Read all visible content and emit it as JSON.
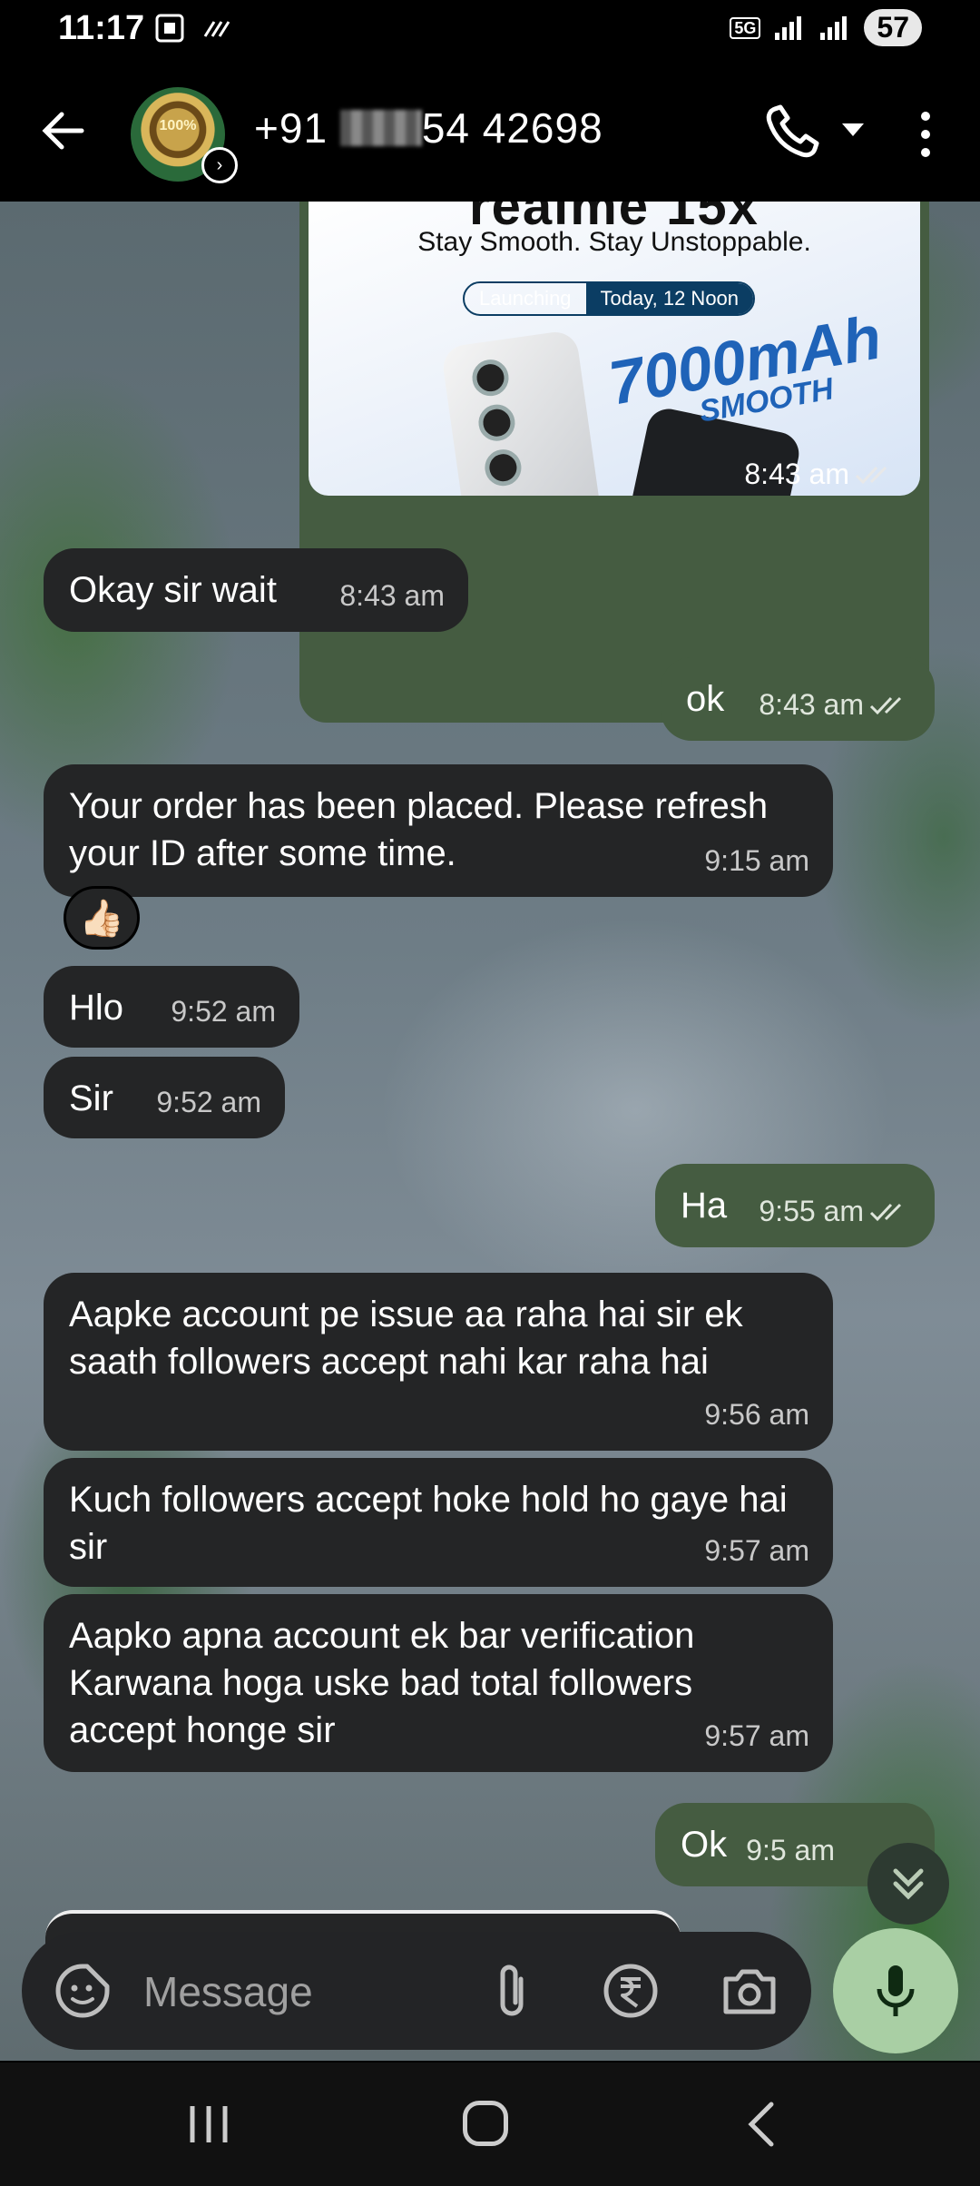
{
  "status_bar": {
    "time": "11:17",
    "network": "5G",
    "battery": "57"
  },
  "header": {
    "avatar_text": "100%",
    "contact_prefix": "+91",
    "contact_suffix": "54 42698"
  },
  "image_message": {
    "brand_partial": "realme 15x",
    "tagline": "Stay Smooth. Stay Unstoppable.",
    "pill_left": "Launching",
    "pill_right": "Today, 12 Noon",
    "battery_big": "7000mAh",
    "battery_small": "SMOOTH",
    "time": "8:43 am"
  },
  "messages": [
    {
      "direction": "in",
      "text": "Okay sir wait",
      "time": "8:43 am"
    },
    {
      "direction": "out",
      "text": "ok",
      "time": "8:43 am"
    },
    {
      "direction": "in",
      "text": "Your order has been placed. Please refresh your ID after some time.",
      "time": "9:15 am"
    },
    {
      "direction": "in",
      "text": "Hlo",
      "time": "9:52 am"
    },
    {
      "direction": "in",
      "text": "Sir",
      "time": "9:52 am"
    },
    {
      "direction": "out",
      "text": "Ha",
      "time": "9:55 am"
    },
    {
      "direction": "in",
      "text": "Aapke account pe issue aa raha hai sir ek saath followers accept nahi kar raha hai",
      "time": "9:56 am"
    },
    {
      "direction": "in",
      "text": "Kuch followers accept hoke hold ho gaye hai sir",
      "time": "9:57 am"
    },
    {
      "direction": "in",
      "text": "Aapko apna account ek bar verification Karwana hoga uske bad total followers accept honge sir",
      "time": "9:57 am"
    },
    {
      "direction": "out",
      "text": "Ok",
      "time": "9:5 am"
    }
  ],
  "reaction": "👍🏻",
  "input": {
    "placeholder": "Message"
  },
  "icons": {
    "back": "back-arrow-icon",
    "call": "phone-icon",
    "more": "more-vertical-icon",
    "emoji": "emoji-sticker-icon",
    "attach": "paperclip-icon",
    "payment": "rupee-icon",
    "camera": "camera-icon",
    "mic": "microphone-icon",
    "scroll": "chevrons-down-icon"
  },
  "colors": {
    "incoming_bubble": "#242526",
    "outgoing_bubble": "#455c41",
    "mic_button": "#a9cfa4"
  }
}
